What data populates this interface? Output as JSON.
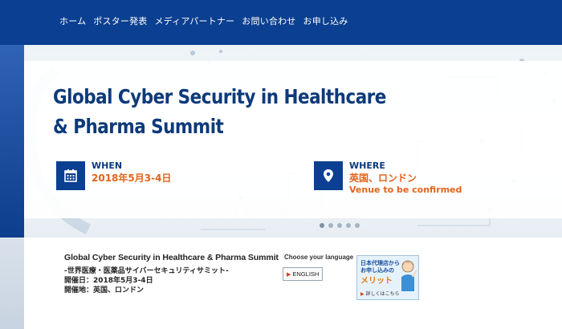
{
  "nav": {
    "items": [
      "ホーム",
      "ポスター発表",
      "メディアパートナー",
      "お問い合わせ",
      "お申し込み"
    ]
  },
  "hero": {
    "title_line1": "Global Cyber Security in Healthcare",
    "title_line2": "& Pharma Summit",
    "when": {
      "label": "WHEN",
      "value": "2018年5月3-4日",
      "icon": "calendar-icon"
    },
    "where": {
      "label": "WHERE",
      "value": "英国、ロンドン",
      "note": "Venue to be confirmed",
      "icon": "map-pin-icon"
    },
    "slider_dots": 5,
    "active_dot": 0
  },
  "summary": {
    "title": "Global Cyber Security in Healthcare & Pharma Summit",
    "subtitle": "-世界医療・医薬品サイバーセキュリティサミット-",
    "date": "開催日：2018年5月3-4日",
    "venue": "開催地：英国、ロンドン"
  },
  "language": {
    "label": "Choose your language",
    "button": "ENGLISH"
  },
  "banner": {
    "line1": "日本代理店から",
    "line2": "お申し込みの",
    "line3": "メリット",
    "link": "詳しくはこちら"
  },
  "colors": {
    "nav_bg": "#0b3f91",
    "title": "#0d3a7a",
    "accent_orange": "#e2631b"
  }
}
